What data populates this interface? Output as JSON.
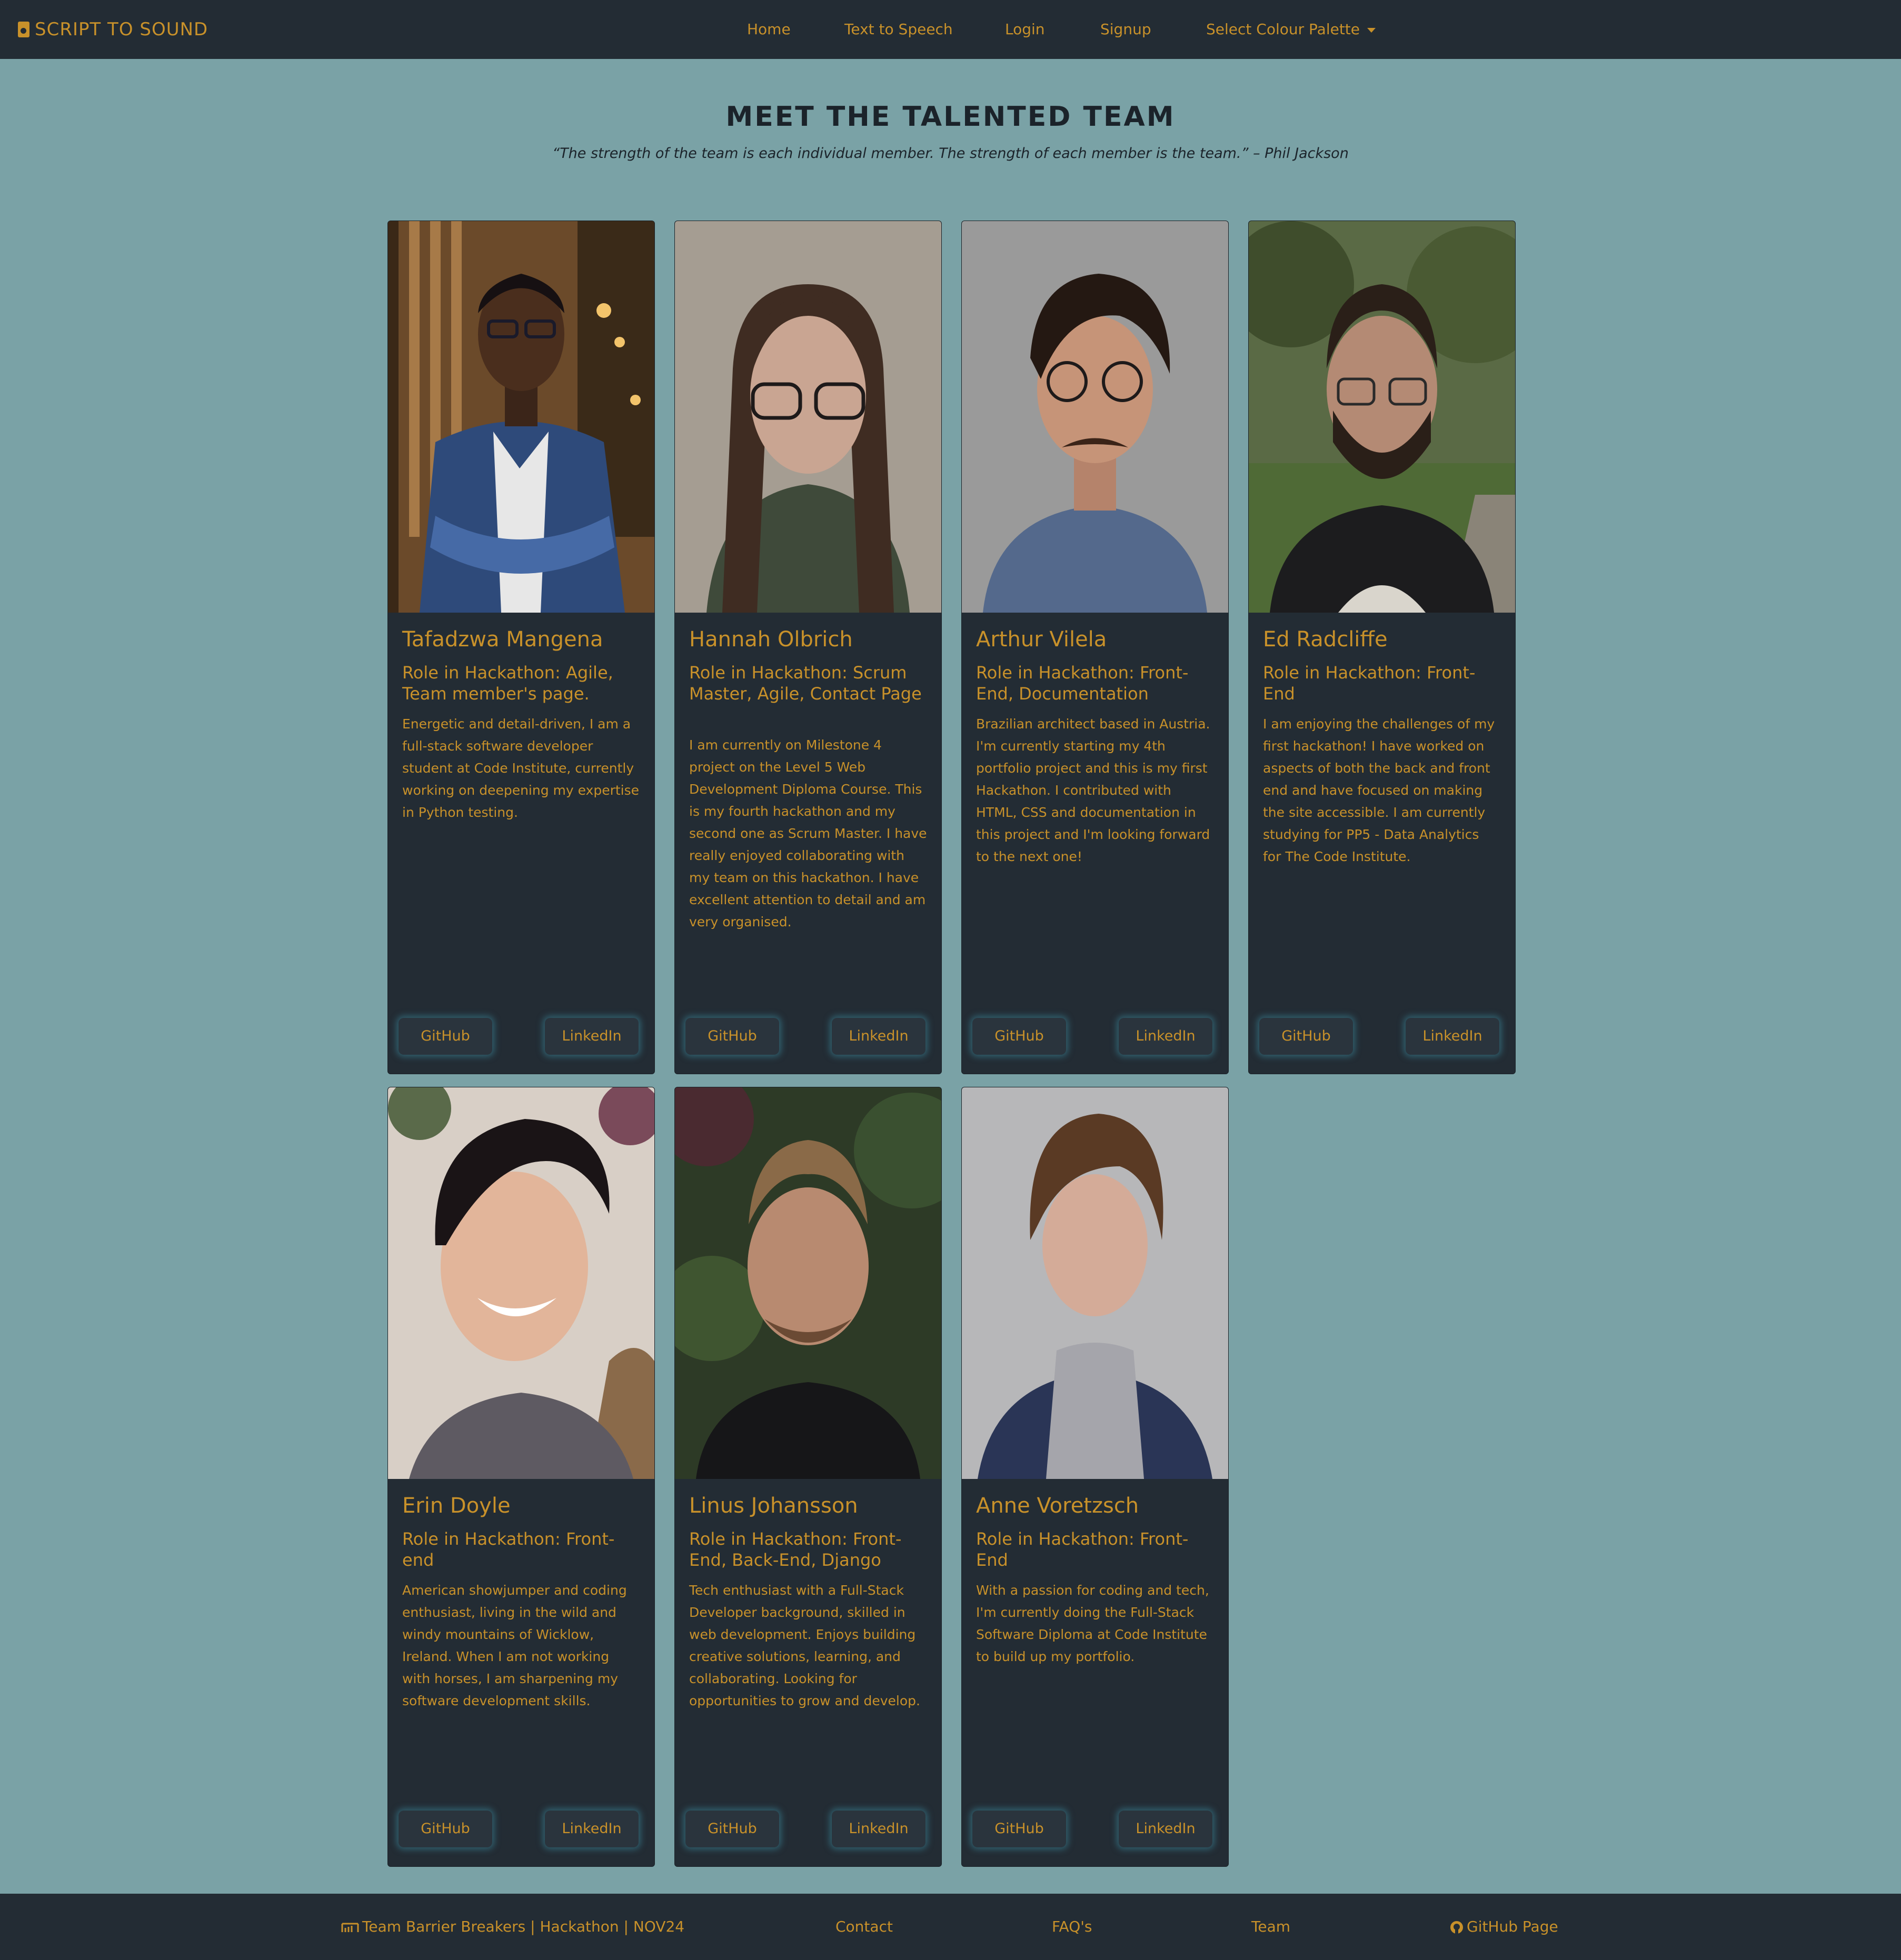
{
  "navbar": {
    "brand": "SCRIPT TO SOUND",
    "brand_icon": "file-audio-icon",
    "links": [
      "Home",
      "Text to Speech",
      "Login",
      "Signup",
      "Select Colour Palette"
    ]
  },
  "hero": {
    "title": "MEET THE TALENTED TEAM",
    "quote": "“The strength of the team is each individual member. The strength of each member is the team.” – Phil Jackson"
  },
  "buttons": {
    "github": "GitHub",
    "linkedin": "LinkedIn"
  },
  "team": [
    {
      "name": "Tafadzwa Mangena",
      "role": "Role in Hackathon: Agile, Team member's page.",
      "bio": "Energetic and detail-driven, I am a full-stack software developer student at Code Institute, currently working on deepening my expertise in Python testing."
    },
    {
      "name": "Hannah Olbrich",
      "role": "Role in Hackathon: Scrum Master, Agile, Contact Page",
      "bio": "I am currently on Milestone 4 project on the Level 5 Web Development Diploma Course. This is my fourth hackathon and my second one as Scrum Master. I have really enjoyed collaborating with my team on this hackathon. I have excellent attention to detail and am very organised."
    },
    {
      "name": "Arthur Vilela",
      "role": "Role in Hackathon: Front-End, Documentation",
      "bio": "Brazilian architect based in Austria. I'm currently starting my 4th portfolio project and this is my first Hackathon. I contributed with HTML, CSS and documentation in this project and I'm looking forward to the next one!"
    },
    {
      "name": "Ed Radcliffe",
      "role": "Role in Hackathon: Front-End",
      "bio": "I am enjoying the challenges of my first hackathon! I have worked on aspects of both the back and front end and have focused on making the site accessible. I am currently studying for PP5 - Data Analytics for The Code Institute."
    },
    {
      "name": "Erin Doyle",
      "role": "Role in Hackathon: Front-end",
      "bio": "American showjumper and coding enthusiast, living in the wild and windy mountains of Wicklow, Ireland. When I am not working with horses, I am sharpening my software development skills."
    },
    {
      "name": "Linus Johansson",
      "role": "Role in Hackathon: Front-End, Back-End, Django",
      "bio": "Tech enthusiast with a Full-Stack Developer background, skilled in web development. Enjoys building creative solutions, learning, and collaborating. Looking for opportunities to grow and develop."
    },
    {
      "name": "Anne Voretzsch",
      "role": "Role in Hackathon: Front-End",
      "bio": "With a passion for coding and tech, I'm currently doing the Full-Stack Software Diploma at Code Institute to build up my portfolio."
    }
  ],
  "footer": {
    "team_label": "Team Barrier Breakers | Hackathon | NOV24",
    "contact": "Contact",
    "faqs": "FAQ's",
    "team": "Team",
    "github": "GitHub Page"
  },
  "colors": {
    "nav_bg": "#232c34",
    "page_bg": "#7aa2a6",
    "accent": "#c8912a"
  }
}
